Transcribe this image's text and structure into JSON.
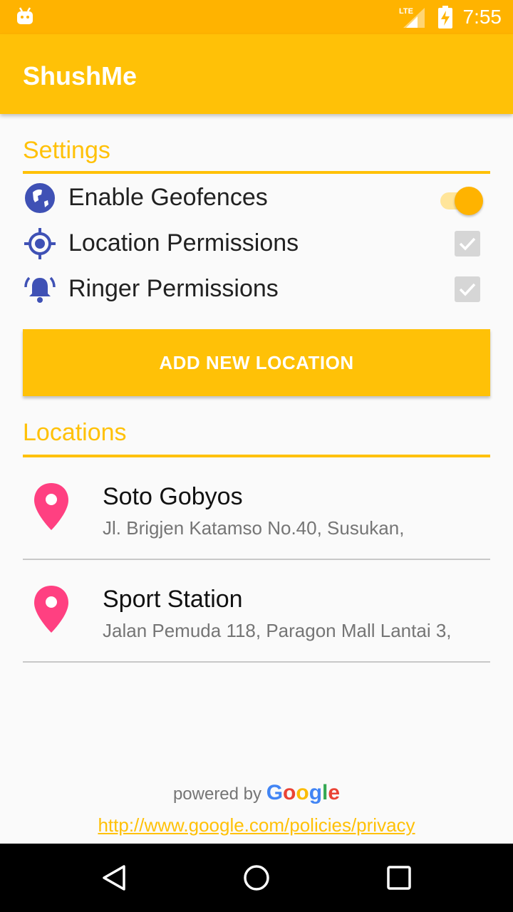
{
  "status_bar": {
    "time": "7:55",
    "network": "LTE"
  },
  "app_bar": {
    "title": "ShushMe"
  },
  "settings": {
    "header": "Settings",
    "items": [
      {
        "label": "Enable Geofences",
        "icon": "globe-icon",
        "control": "switch",
        "on": true
      },
      {
        "label": "Location Permissions",
        "icon": "gps-target-icon",
        "control": "checkbox",
        "checked": true
      },
      {
        "label": "Ringer Permissions",
        "icon": "ringer-bell-icon",
        "control": "checkbox",
        "checked": true
      }
    ]
  },
  "add_button": {
    "label": "ADD NEW LOCATION"
  },
  "locations": {
    "header": "Locations",
    "items": [
      {
        "name": "Soto Gobyos",
        "address": "Jl. Brigjen Katamso No.40, Susukan,"
      },
      {
        "name": "Sport Station",
        "address": "Jalan Pemuda 118, Paragon Mall Lantai 3,"
      }
    ]
  },
  "footer": {
    "powered_by": "powered by",
    "google": [
      "G",
      "o",
      "o",
      "g",
      "l",
      "e"
    ],
    "privacy_url": "http://www.google.com/policies/privacy"
  },
  "colors": {
    "accent": "#ffc107",
    "status_bar": "#ffb300",
    "icon_blue": "#3f51b5",
    "pin_pink": "#ff4081",
    "google": [
      "#4285f4",
      "#ea4335",
      "#fbbc05",
      "#4285f4",
      "#34a853",
      "#ea4335"
    ]
  }
}
